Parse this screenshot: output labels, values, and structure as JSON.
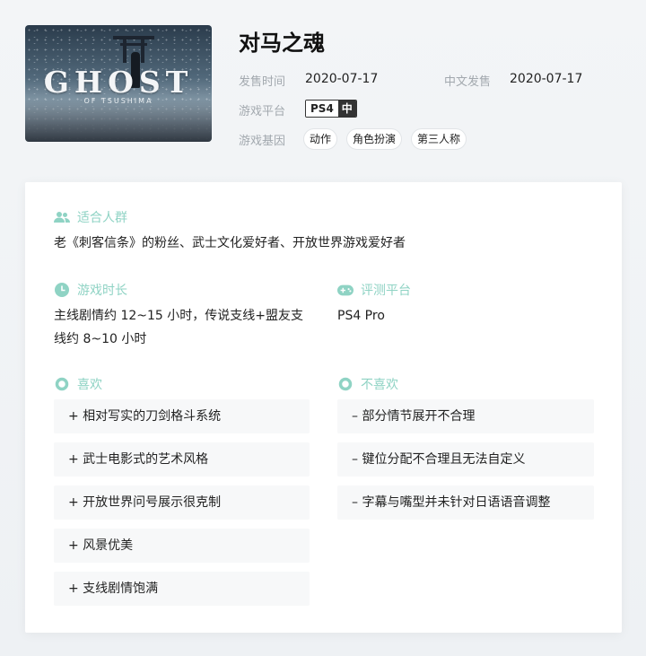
{
  "game": {
    "title": "对马之魂",
    "cover": {
      "logo_text": "GHOST",
      "logo_sub": "OF TSUSHIMA"
    },
    "release_label": "发售时间",
    "release_value": "2020-07-17",
    "cn_release_label": "中文发售",
    "cn_release_value": "2020-07-17",
    "platform_label": "游戏平台",
    "platform_name": "PS4",
    "platform_badge": "中",
    "genre_label": "游戏基因",
    "genres": [
      "动作",
      "角色扮演",
      "第三人称"
    ]
  },
  "review": {
    "audience": {
      "title": "适合人群",
      "icon": "people-icon",
      "text": "老《刺客信条》的粉丝、武士文化爱好者、开放世界游戏爱好者"
    },
    "duration": {
      "title": "游戏时长",
      "icon": "clock-icon",
      "text_line1": "主线剧情约 12~15 小时，传说支线+盟友支",
      "text_line2": "线约 8~10 小时"
    },
    "platform": {
      "title": "评测平台",
      "icon": "gamepad-icon",
      "text": "PS4 Pro"
    },
    "likes": {
      "title": "喜欢",
      "icon": "ring-icon",
      "items": [
        "+ 相对写实的刀剑格斗系统",
        "+ 武士电影式的艺术风格",
        "+ 开放世界问号展示很克制",
        "+ 风景优美",
        "+ 支线剧情饱满"
      ]
    },
    "dislikes": {
      "title": "不喜欢",
      "icon": "ring-icon",
      "items": [
        "– 部分情节展开不合理",
        "– 键位分配不合理且无法自定义",
        "– 字幕与嘴型并未针对日语语音调整"
      ]
    }
  },
  "colors": {
    "accent": "#8fd3c4",
    "label": "#a2a8ae"
  }
}
